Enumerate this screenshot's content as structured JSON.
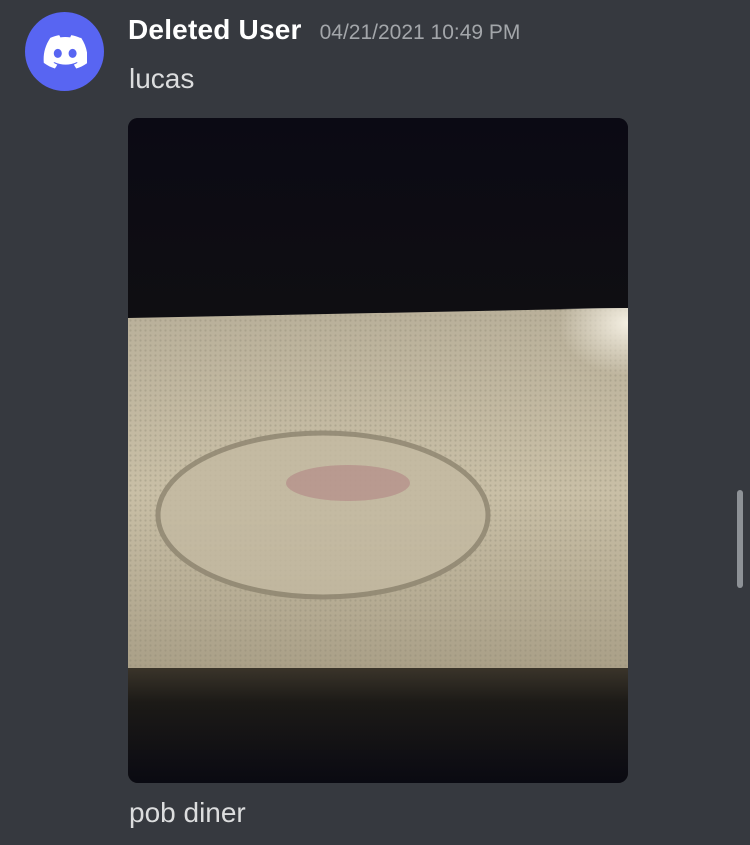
{
  "message": {
    "avatar_icon": "discord-logo-icon",
    "avatar_color": "#5865f2",
    "username": "Deleted User",
    "timestamp": "04/21/2021 10:49 PM",
    "content": "lucas",
    "attachment": {
      "type": "image",
      "description_icon": "photo-attachment"
    },
    "caption": "pob diner"
  },
  "theme": {
    "background": "#36393f",
    "username_color": "#ffffff",
    "text_color": "#dcddde",
    "timestamp_color": "#a3a6aa"
  }
}
